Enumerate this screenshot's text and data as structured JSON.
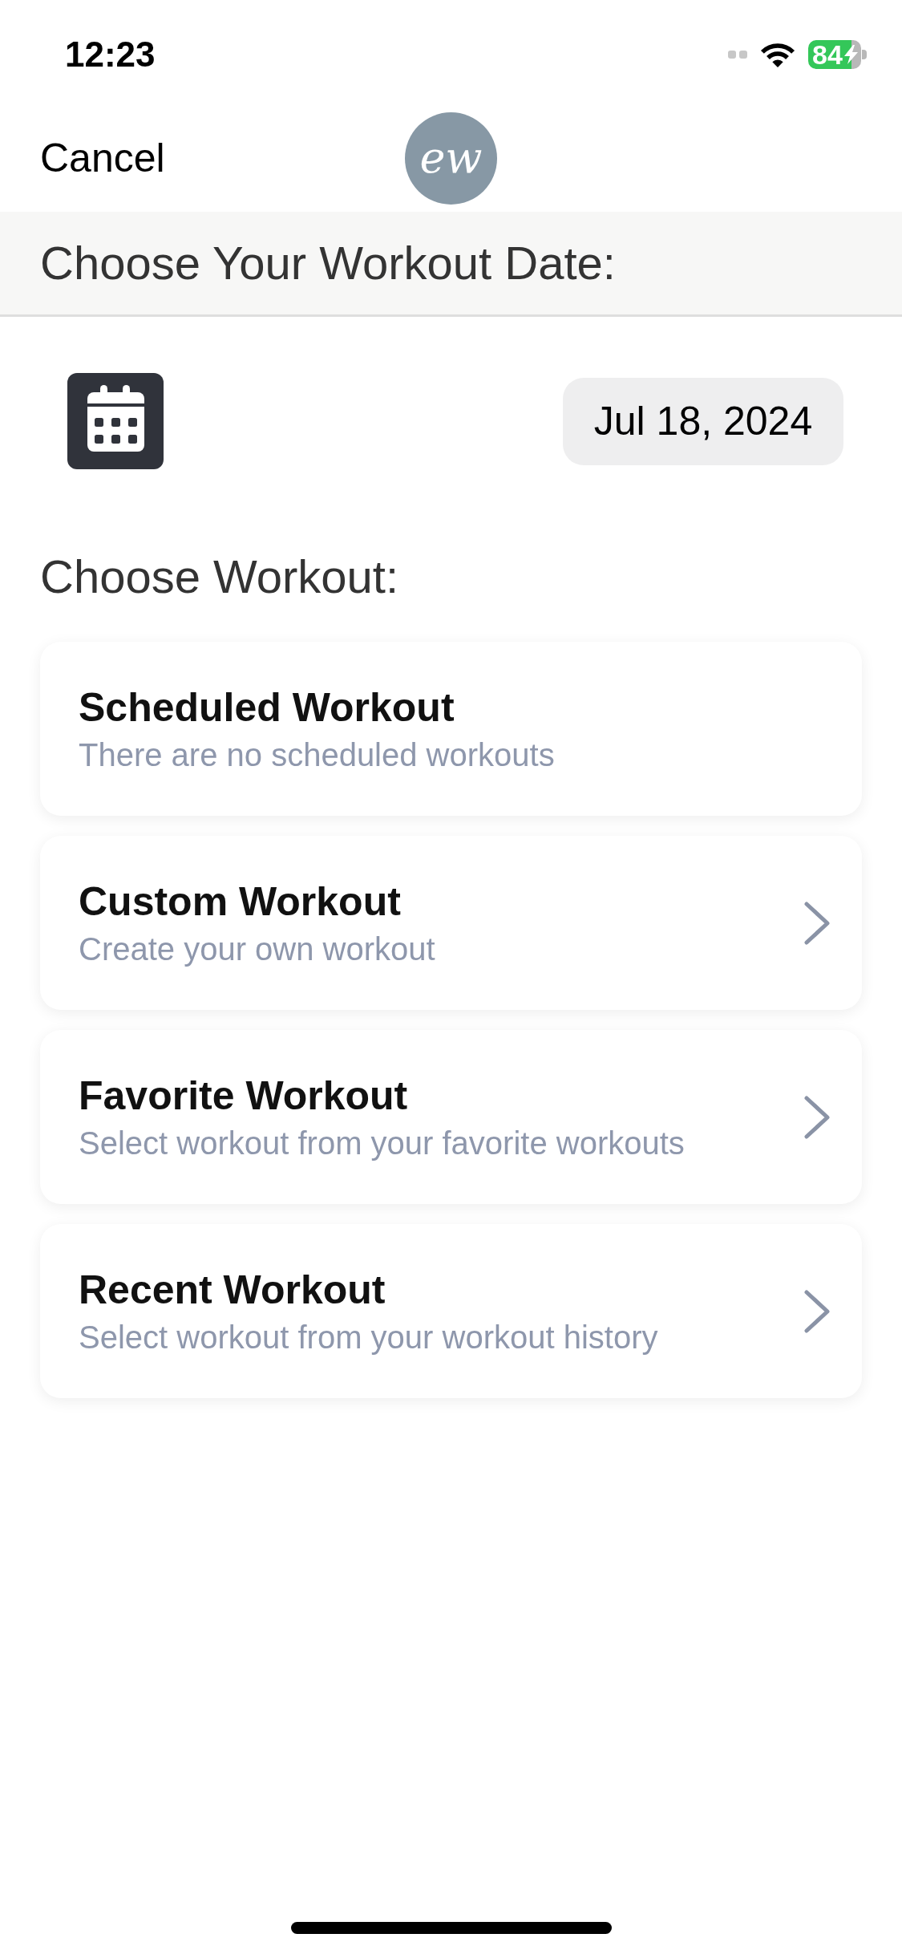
{
  "status_bar": {
    "time": "12:23",
    "battery": "84"
  },
  "nav_bar": {
    "cancel": "Cancel",
    "logo": "ew"
  },
  "date_section": {
    "title": "Choose Your Workout Date:",
    "date": "Jul 18, 2024"
  },
  "workout_section": {
    "title": "Choose Workout:",
    "options": [
      {
        "kind": "static",
        "title": "Scheduled Workout",
        "subtitle": "There are no scheduled workouts"
      },
      {
        "kind": "link",
        "title": "Custom Workout",
        "subtitle": "Create your own workout"
      },
      {
        "kind": "link",
        "title": "Favorite Workout",
        "subtitle": "Select workout from your favorite workouts"
      },
      {
        "kind": "link",
        "title": "Recent Workout",
        "subtitle": "Select workout from your workout history"
      }
    ]
  }
}
